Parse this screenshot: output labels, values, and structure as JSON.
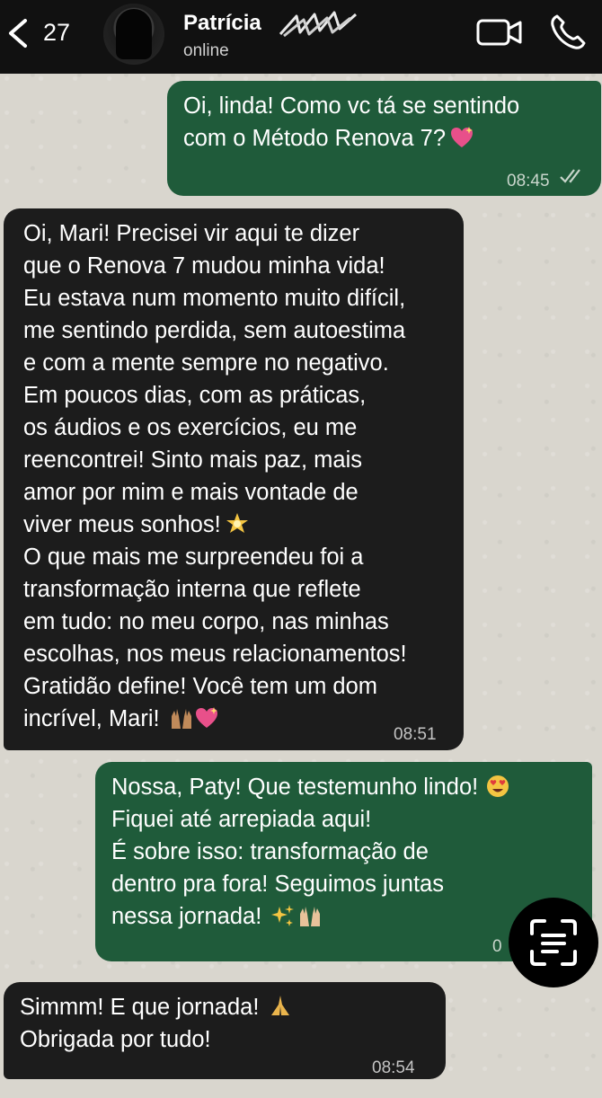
{
  "header": {
    "back_count": "27",
    "contact_name": "Patrícia",
    "status": "online",
    "icons": [
      "chevron-left-icon",
      "video-call-icon",
      "phone-icon"
    ]
  },
  "messages": [
    {
      "direction": "outgoing",
      "text": "Oi, linda! Como vc tá se sentindo\ncom o Método Renova 7?",
      "emoji": "sparkling-heart",
      "time": "08:45",
      "read": true
    },
    {
      "direction": "incoming",
      "text": "Oi, Mari! Precisei vir aqui te dizer\nque o Renova 7 mudou minha vida!\nEu estava num momento muito difícil,\nme sentindo perdida, sem autoestima\ne com a mente sempre no negativo.\nEm poucos dias, com as práticas,\nos áudios e os exercícios, eu me\nreencontrei! Sinto mais paz, mais\namor por mim e mais vontade de\nviver meus sonhos!",
      "emoji": "glowing-star",
      "text2": "O que mais me surpreendeu foi a\ntransformação interna que reflete\nem tudo: no meu corpo, nas minhas\nescolhas, nos meus relacionamentos!\nGratidão define! Você tem um dom\nincrível, Mari!",
      "emoji2": [
        "raising-hands",
        "sparkling-heart"
      ],
      "time": "08:51"
    },
    {
      "direction": "outgoing",
      "text": "Nossa, Paty! Que testemunho lindo!",
      "emoji": "heart-eyes",
      "text2": "Fiquei até arrepiada aqui!\nÉ sobre isso: transformação de\ndentro pra fora! Seguimos juntas\nnessa jornada!",
      "emoji2": [
        "sparkles",
        "raising-hands"
      ],
      "time_partial": "0"
    },
    {
      "direction": "incoming",
      "text": "Simmm! E que jornada!",
      "emoji": "folded-hands",
      "text2": "Obrigada por tudo!",
      "time": "08:54"
    }
  ],
  "overlay": {
    "icon": "scan-text-icon"
  },
  "colors": {
    "header_bg": "#111111",
    "chat_bg": "#d9d6ce",
    "outgoing_bubble": "#1f5b3a",
    "incoming_bubble": "#1c1c1c"
  }
}
